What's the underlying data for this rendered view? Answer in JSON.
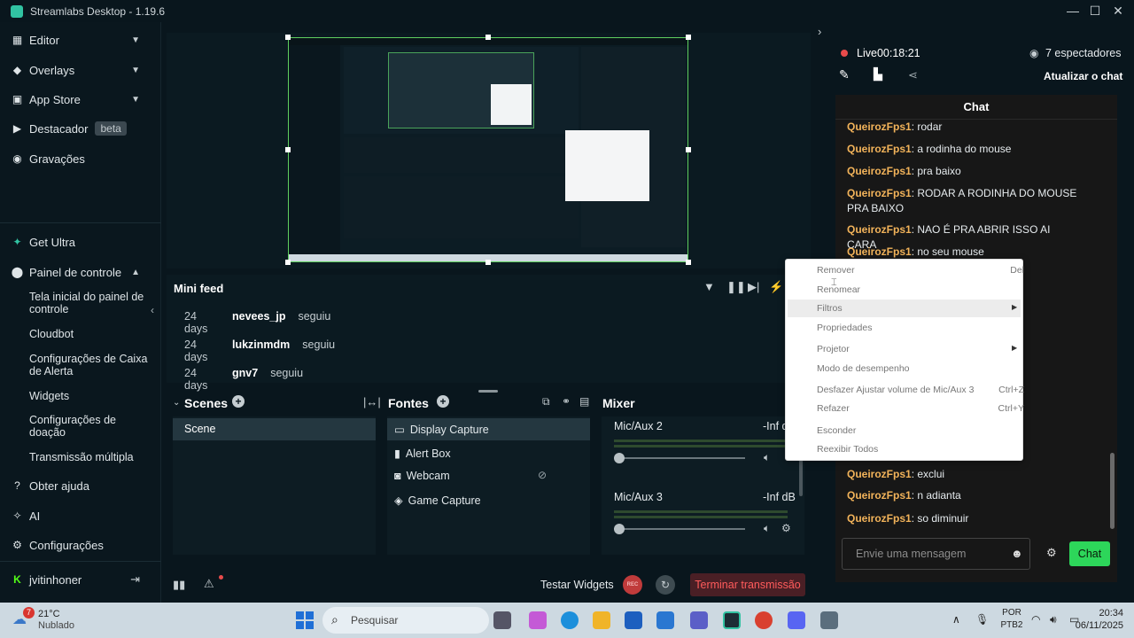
{
  "window": {
    "title": "Streamlabs Desktop - 1.19.6"
  },
  "sidebar": {
    "items": [
      {
        "label": "Editor",
        "icon": "editor-icon"
      },
      {
        "label": "Overlays",
        "icon": "overlays-icon"
      },
      {
        "label": "App Store",
        "icon": "app-store-icon"
      },
      {
        "label": "Destacador",
        "icon": "highlighter-icon",
        "badge": "beta"
      },
      {
        "label": "Gravações",
        "icon": "recordings-icon"
      },
      {
        "label": "Get Ultra",
        "icon": "ultra-icon"
      },
      {
        "label": "Painel de controle",
        "icon": "dashboard-icon"
      },
      {
        "label": "Obter ajuda",
        "icon": "help-icon"
      },
      {
        "label": "AI",
        "icon": "ai-icon"
      },
      {
        "label": "Configurações",
        "icon": "settings-icon"
      }
    ],
    "subitems": [
      "Tela inicial do painel de controle",
      "Cloudbot",
      "Configurações de Caixa de Alerta",
      "Widgets",
      "Configurações de doação",
      "Transmissão múltipla"
    ],
    "user": "jvitinhoner"
  },
  "minifeed": {
    "title": "Mini feed",
    "rows": [
      {
        "days": "24 days",
        "name": "nevees_jp",
        "action": "seguiu"
      },
      {
        "days": "24 days",
        "name": "lukzinmdm",
        "action": "seguiu"
      },
      {
        "days": "24 days",
        "name": "gnv7",
        "action": "seguiu"
      }
    ]
  },
  "scenes": {
    "title": "Scenes",
    "items": [
      "Scene"
    ]
  },
  "sources": {
    "title": "Fontes",
    "items": [
      "Display Capture",
      "Alert Box",
      "Webcam",
      "Game Capture"
    ]
  },
  "mixer": {
    "title": "Mixer",
    "channels": [
      {
        "name": "Mic/Aux 2",
        "level": "-Inf d"
      },
      {
        "name": "Mic/Aux 3",
        "level": "-Inf dB"
      }
    ]
  },
  "footer": {
    "test_widgets": "Testar Widgets",
    "rec": "REC",
    "end_stream": "Terminar transmissão"
  },
  "live": {
    "status": "Live",
    "time": "00:18:21",
    "viewers": "7 espectadores",
    "refresh_chat": "Atualizar o chat"
  },
  "chat": {
    "title": "Chat",
    "messages": [
      {
        "user": "QueirozFps1",
        "text": ": rodar"
      },
      {
        "user": "QueirozFps1",
        "text": ": a rodinha do mouse"
      },
      {
        "user": "QueirozFps1",
        "text": ": pra baixo"
      },
      {
        "user": "QueirozFps1",
        "text": ": RODAR A RODINHA DO MOUSE PRA BAIXO"
      },
      {
        "user": "QueirozFps1",
        "text": ": NAO É PRA ABRIR ISSO AI CARA"
      },
      {
        "user": "QueirozFps1",
        "text": ": no seu mouse"
      },
      {
        "user": "QueirozFps1",
        "text": ": exclui"
      },
      {
        "user": "QueirozFps1",
        "text": ": n adianta"
      },
      {
        "user": "QueirozFps1",
        "text": ": so diminuir"
      }
    ],
    "input_placeholder": "Envie uma mensagem",
    "send_label": "Chat"
  },
  "context_menu": {
    "items": [
      {
        "label": "Remover",
        "shortcut": "Del"
      },
      {
        "label": "Renomear",
        "shortcut": ""
      },
      {
        "label": "Filtros",
        "shortcut": "",
        "submenu": true
      },
      {
        "label": "Propriedades",
        "shortcut": ""
      },
      {
        "label": "Projetor",
        "shortcut": "",
        "submenu": true
      },
      {
        "label": "Modo de desempenho",
        "shortcut": ""
      },
      {
        "label": "Desfazer Ajustar volume de Mic/Aux 3",
        "shortcut": "Ctrl+Z"
      },
      {
        "label": "Refazer",
        "shortcut": "Ctrl+Y"
      },
      {
        "label": "Esconder",
        "shortcut": ""
      },
      {
        "label": "Reexibir Todos",
        "shortcut": ""
      }
    ]
  },
  "taskbar": {
    "weather_temp": "21°C",
    "weather_desc": "Nublado",
    "weather_badge": "7",
    "search_placeholder": "Pesquisar",
    "lang": "POR",
    "layout": "PTB2",
    "time": "20:34",
    "date": "06/11/2025"
  },
  "colors": {
    "accent": "#31c3a2",
    "live_red": "#e84b4b",
    "chat_user": "#f2b35a",
    "send_green": "#2dd65a"
  }
}
